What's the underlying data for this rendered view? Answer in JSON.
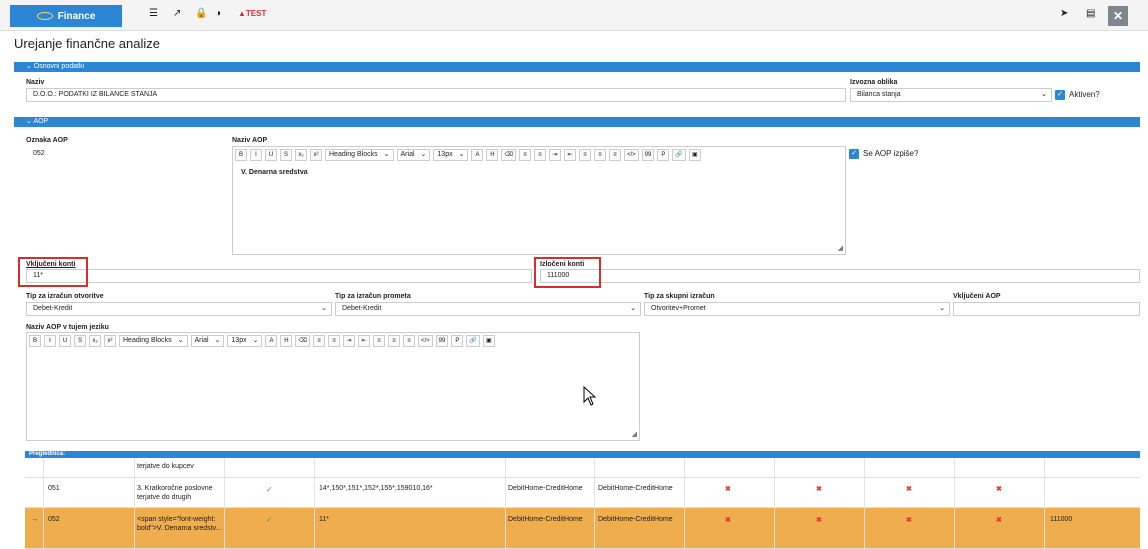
{
  "topbar": {
    "brand": "Finance",
    "test_label": "TEST",
    "icons": [
      "list-icon",
      "external-link-icon",
      "lock-icon",
      "contrast-icon",
      "warning-icon",
      "send-icon",
      "menu-icon",
      "close-icon"
    ]
  },
  "page_title": "Urejanje finančne analize",
  "sections": {
    "osnovni": "Osnovni podatki",
    "aop": "AOP"
  },
  "osnovni": {
    "naziv_label": "Naziv",
    "naziv_value": "D.O.O.: PODATKI IZ BILANCE STANJA",
    "izvozna_label": "Izvozna oblika",
    "izvozna_value": "Bilanca stanja",
    "aktiven_label": "Aktiven?"
  },
  "aop": {
    "oznaka_label": "Oznaka AOP",
    "oznaka_value": "052",
    "naziv_label": "Naziv AOP",
    "naziv_content": "V. Denarna sredstva",
    "izpise_label": "Se AOP izpiše?",
    "vkljuceni_label": "Vključeni konti",
    "vkljuceni_value": "11*",
    "izloceni_label": "Izločeni konti",
    "izloceni_value": "111000",
    "tip_otvoritve_label": "Tip za izračun otvoritve",
    "tip_otvoritve_value": "Debet-Kredit",
    "tip_prometa_label": "Tip za izračun prometa",
    "tip_prometa_value": "Debet-Kredit",
    "tip_skupni_label": "Tip za skupni izračun",
    "tip_skupni_value": "Otvoritev+Promet",
    "vkljuceni_aop_label": "Vključeni AOP",
    "naziv_tuji_label": "Naziv AOP v tujem jeziku"
  },
  "editor_toolbar": {
    "bold": "B",
    "italic": "I",
    "underline": "U",
    "strike": "S",
    "sub": "x₂",
    "sup": "x²",
    "heading": "Heading Blocks",
    "font": "Arial",
    "size": "13px",
    "fore": "A",
    "back": "H",
    "code": "</>",
    "quote": "99",
    "para": "P"
  },
  "grid": {
    "title": "Preglednica:",
    "rows": [
      {
        "code": "",
        "name": "terjatve do kupcev",
        "check": "✓",
        "konti": "",
        "tip1": "",
        "tip2": "",
        "izloceni": ""
      },
      {
        "code": "051",
        "name": "3. Kratkoročne poslovne terjatve do drugih",
        "check": "✓",
        "konti": "14*,150*,151*,152*,155*,159010,16*",
        "tip1": "DebitHome-CreditHome",
        "tip2": "DebitHome-CreditHome",
        "izloceni": ""
      },
      {
        "code": "052",
        "name": "<span style=\"font-weight: bold\">V. Denarna sredstv...",
        "check": "✓",
        "konti": "11*",
        "tip1": "DebitHome-CreditHome",
        "tip2": "DebitHome-CreditHome",
        "izloceni": "111000"
      }
    ],
    "x": "✖",
    "arrow": "→"
  },
  "colors": {
    "accent": "#2c86d6",
    "selected_row": "#f0ad4e",
    "highlight": "#d32f2f"
  }
}
